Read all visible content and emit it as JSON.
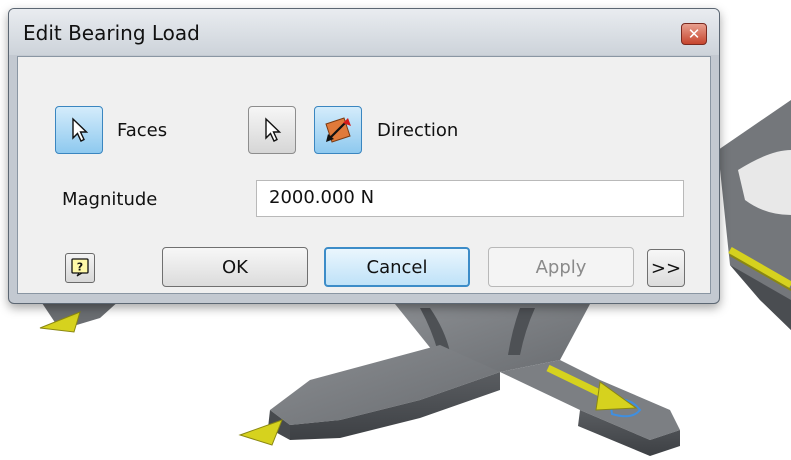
{
  "dialog": {
    "title": "Edit Bearing Load",
    "close_icon": "close-icon"
  },
  "selection": {
    "faces_label": "Faces",
    "direction_label": "Direction",
    "icons": [
      "cursor-arrow-icon",
      "flip-direction-icon",
      "help-icon"
    ]
  },
  "magnitude": {
    "label": "Magnitude",
    "value": "2000.000 N"
  },
  "buttons": {
    "ok": "OK",
    "cancel": "Cancel",
    "apply": "Apply",
    "expand": ">>"
  },
  "colors": {
    "active_button": "#8ec9ef",
    "close_button": "#c6452e",
    "part_gray": "#6b6e72",
    "load_arrow": "#d6d21e"
  }
}
